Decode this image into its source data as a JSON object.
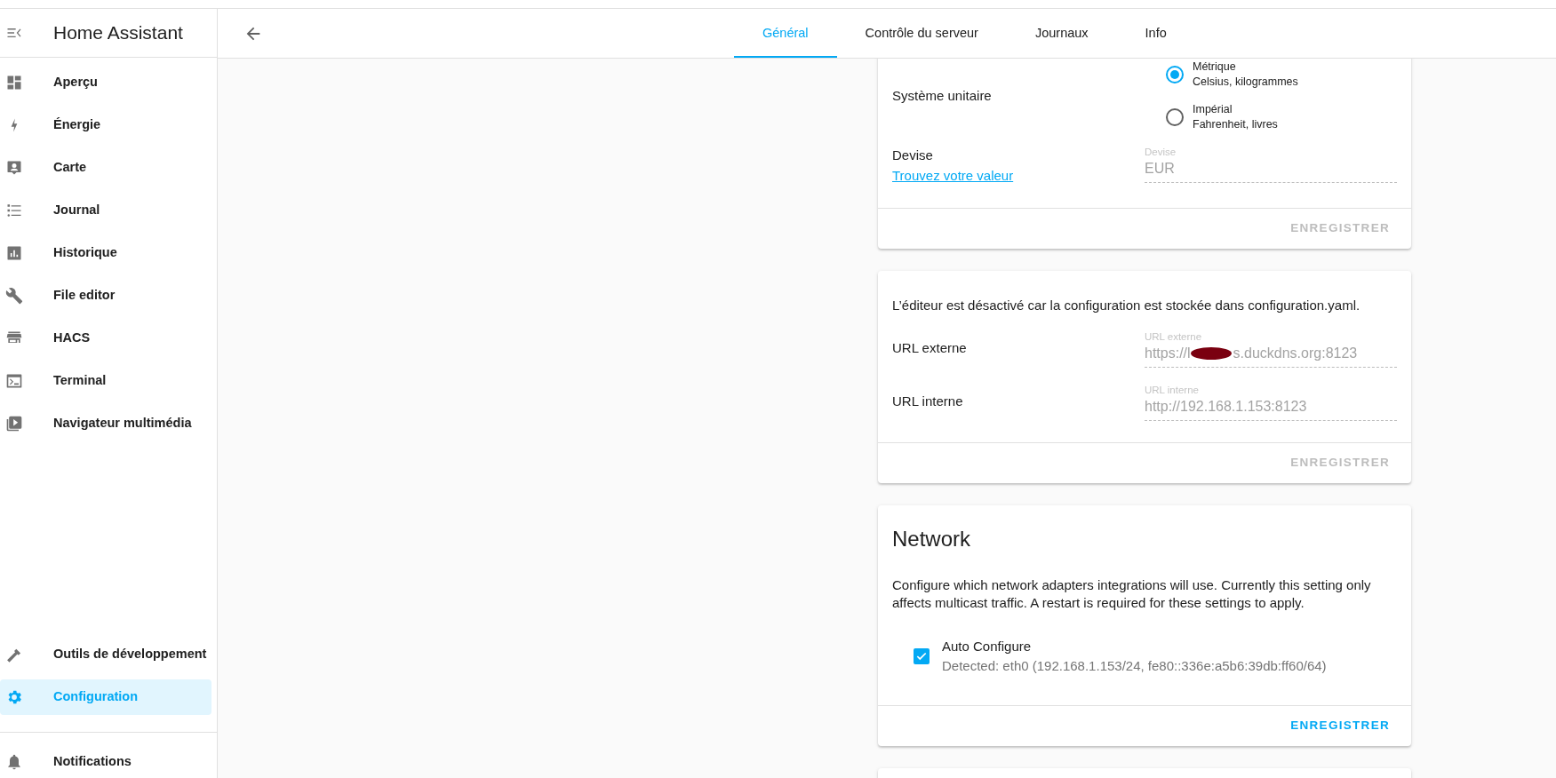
{
  "sidebar": {
    "title": "Home Assistant",
    "items": [
      {
        "label": "Aperçu",
        "selected": false
      },
      {
        "label": "Énergie",
        "selected": false
      },
      {
        "label": "Carte",
        "selected": false
      },
      {
        "label": "Journal",
        "selected": false
      },
      {
        "label": "Historique",
        "selected": false
      },
      {
        "label": "File editor",
        "selected": false
      },
      {
        "label": "HACS",
        "selected": false
      },
      {
        "label": "Terminal",
        "selected": false
      },
      {
        "label": "Navigateur multimédia",
        "selected": false
      }
    ],
    "bottom_items": [
      {
        "label": "Outils de développement",
        "selected": false
      },
      {
        "label": "Configuration",
        "selected": true
      }
    ],
    "notifications": {
      "label": "Notifications"
    }
  },
  "header": {
    "tabs": [
      {
        "label": "Général",
        "selected": true
      },
      {
        "label": "Contrôle du serveur",
        "selected": false
      },
      {
        "label": "Journaux",
        "selected": false
      },
      {
        "label": "Info",
        "selected": false
      }
    ]
  },
  "cards": [
    {
      "kind": "general",
      "unit_system": {
        "label": "Système unitaire",
        "options": [
          {
            "title": "Métrique",
            "subtitle": "Celsius, kilogrammes",
            "selected": true
          },
          {
            "title": "Impérial",
            "subtitle": "Fahrenheit, livres",
            "selected": false
          }
        ]
      },
      "currency": {
        "label": "Devise",
        "link": "Trouvez votre valeur",
        "field_label": "Devise",
        "value": "EUR",
        "disabled": true
      },
      "save": {
        "label": "ENREGISTRER",
        "disabled": true
      }
    },
    {
      "kind": "urls",
      "notice": "L’éditeur est désactivé car la configuration est stockée dans configuration.yaml.",
      "fields": [
        {
          "label": "URL externe",
          "field_label": "URL externe",
          "value": "https://l",
          "value_after_redaction": "s.duckdns.org:8123",
          "disabled": true
        },
        {
          "label": "URL interne",
          "field_label": "URL interne",
          "value": "http://192.168.1.153:8123",
          "disabled": true
        }
      ],
      "save": {
        "label": "ENREGISTRER",
        "disabled": true
      }
    },
    {
      "kind": "network",
      "title": "Network",
      "description": "Configure which network adapters integrations will use. Currently this setting only affects multicast traffic. A restart is required for these settings to apply.",
      "adapters": [
        {
          "label": "Auto Configure",
          "detail": "Detected: eth0 (192.168.1.153/24, fe80::336e:a5b6:39db:ff60/64)",
          "checked": true
        }
      ],
      "save": {
        "label": "ENREGISTRER",
        "disabled": false
      }
    },
    {
      "kind": "blank"
    }
  ]
}
